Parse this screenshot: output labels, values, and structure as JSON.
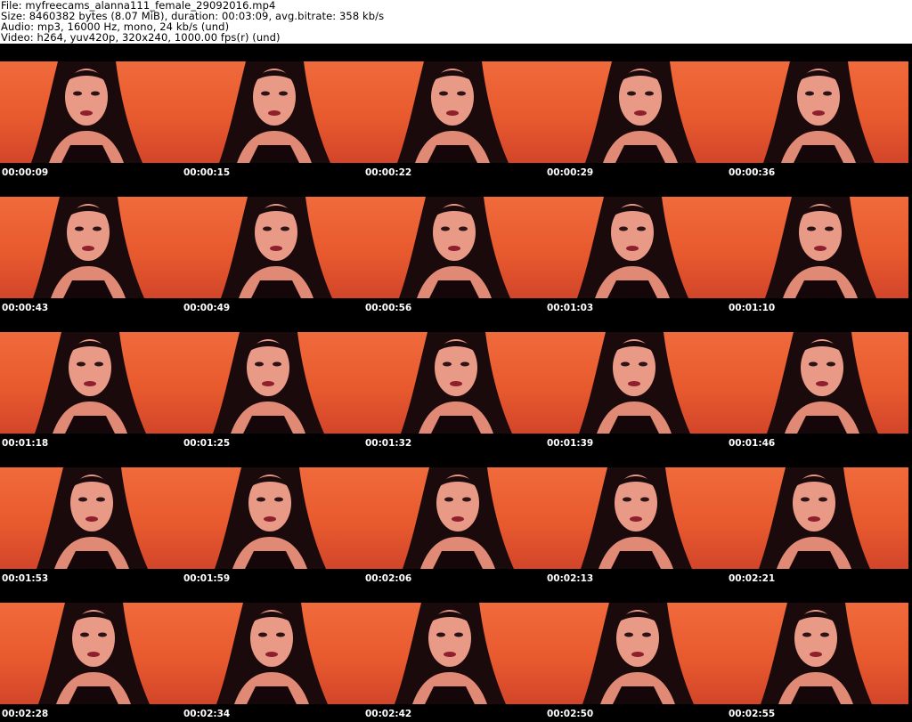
{
  "header": {
    "file": "File: myfreecams_alanna111_female_29092016.mp4",
    "size": "Size: 8460382 bytes (8.07 MiB), duration: 00:03:09, avg.bitrate: 358 kb/s",
    "audio": "Audio: mp3, 16000 Hz, mono, 24 kb/s (und)",
    "video": "Video: h264, yuv420p, 320x240, 1000.00 fps(r) (und)"
  },
  "thumbnails": [
    {
      "time": "00:00:09"
    },
    {
      "time": "00:00:15"
    },
    {
      "time": "00:00:22"
    },
    {
      "time": "00:00:29"
    },
    {
      "time": "00:00:36"
    },
    {
      "time": "00:00:43"
    },
    {
      "time": "00:00:49"
    },
    {
      "time": "00:00:56"
    },
    {
      "time": "00:01:03"
    },
    {
      "time": "00:01:10"
    },
    {
      "time": "00:01:18"
    },
    {
      "time": "00:01:25"
    },
    {
      "time": "00:01:32"
    },
    {
      "time": "00:01:39"
    },
    {
      "time": "00:01:46"
    },
    {
      "time": "00:01:53"
    },
    {
      "time": "00:01:59"
    },
    {
      "time": "00:02:06"
    },
    {
      "time": "00:02:13"
    },
    {
      "time": "00:02:21"
    },
    {
      "time": "00:02:28"
    },
    {
      "time": "00:02:34"
    },
    {
      "time": "00:02:42"
    },
    {
      "time": "00:02:50"
    },
    {
      "time": "00:02:55"
    }
  ]
}
